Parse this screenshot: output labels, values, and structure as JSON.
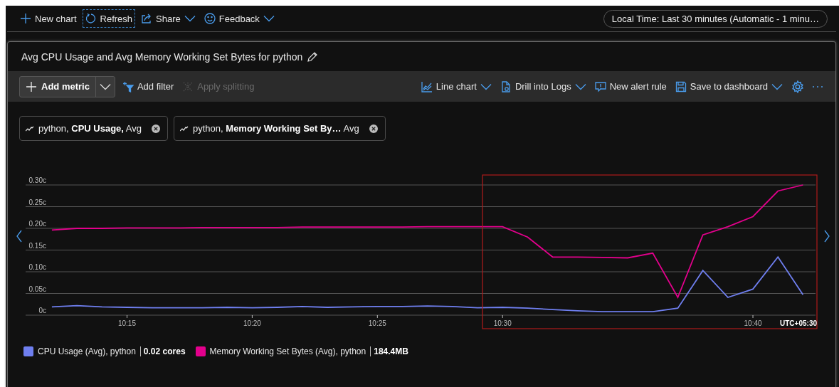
{
  "top_toolbar": [
    {
      "kind": "add",
      "label": "New chart",
      "dropdown": false,
      "focused": false
    },
    {
      "kind": "refresh",
      "label": "Refresh",
      "dropdown": false,
      "focused": true
    },
    {
      "kind": "share",
      "label": "Share",
      "dropdown": true,
      "focused": false
    },
    {
      "kind": "feedback",
      "label": "Feedback",
      "dropdown": true,
      "focused": false
    }
  ],
  "time_range": "Local Time: Last 30 minutes (Automatic - 1 minu…",
  "card": {
    "title": "Avg CPU Usage and Avg Memory Working Set Bytes for python",
    "toolbar_left": [
      {
        "kind": "add-metric",
        "label": "Add metric",
        "disabled": false
      },
      {
        "kind": "filter",
        "label": "Add filter",
        "disabled": false
      },
      {
        "kind": "splitting",
        "label": "Apply splitting",
        "disabled": true
      }
    ],
    "toolbar_right": [
      {
        "kind": "line-chart",
        "label": "Line chart",
        "dropdown": true
      },
      {
        "kind": "logs",
        "label": "Drill into Logs",
        "dropdown": true
      },
      {
        "kind": "alert",
        "label": "New alert rule",
        "dropdown": false
      },
      {
        "kind": "save",
        "label": "Save to dashboard",
        "dropdown": true
      },
      {
        "kind": "settings",
        "dropdown": false
      },
      {
        "kind": "more",
        "dropdown": false
      }
    ],
    "metric_pills": [
      {
        "text": "python, **CPU Usage,** Avg"
      },
      {
        "text": "python, **Memory Working Set By…** Avg"
      }
    ],
    "selection_shown": true,
    "chart_data": {
      "type": "line",
      "grid": true,
      "ylim": [
        0,
        0.3
      ],
      "categories": [
        null,
        null,
        null,
        "10:15",
        null,
        null,
        null,
        null,
        "10:20",
        null,
        null,
        null,
        null,
        "10:25",
        null,
        null,
        null,
        null,
        "10:30",
        null,
        null,
        null,
        null,
        null,
        null,
        null,
        null,
        null,
        "10:40",
        null,
        null
      ],
      "series": [
        {
          "name": "CPU Usage (Avg), python",
          "color": "#6f7ff0",
          "values": [
            0.019,
            0.022,
            0.019,
            0.018,
            0.017,
            0.017,
            0.017,
            0.018,
            0.017,
            0.018,
            0.02,
            0.018,
            0.019,
            0.02,
            0.02,
            0.021,
            0.02,
            0.017,
            0.018,
            0.016,
            0.013,
            0.01,
            0.008,
            0.008,
            0.008,
            0.016,
            0.103,
            0.041,
            0.06,
            0.134,
            0.047
          ]
        },
        {
          "name": "Memory Working Set Bytes (Avg), python",
          "color": "#e3008c",
          "values": [
            0.196,
            0.2,
            0.2,
            0.201,
            0.201,
            0.201,
            0.202,
            0.202,
            0.202,
            0.202,
            0.203,
            0.203,
            0.203,
            0.203,
            0.203,
            0.204,
            0.204,
            0.204,
            0.204,
            0.18,
            0.134,
            0.134,
            0.133,
            0.132,
            0.143,
            0.041,
            0.185,
            0.204,
            0.227,
            0.286,
            0.3
          ]
        }
      ],
      "yticks": [
        {
          "value": 0,
          "label": "0c"
        },
        {
          "value": 0.05,
          "label": "0.05c"
        },
        {
          "value": 0.1,
          "label": "0.10c"
        },
        {
          "value": 0.15,
          "label": "0.15c"
        },
        {
          "value": 0.2,
          "label": "0.20c"
        },
        {
          "value": 0.25,
          "label": "0.25c"
        },
        {
          "value": 0.3,
          "label": "0.30c"
        }
      ]
    },
    "timezone_label": "UTC+05:30",
    "legend_values": [
      "0.02 cores",
      "184.4MB"
    ]
  }
}
